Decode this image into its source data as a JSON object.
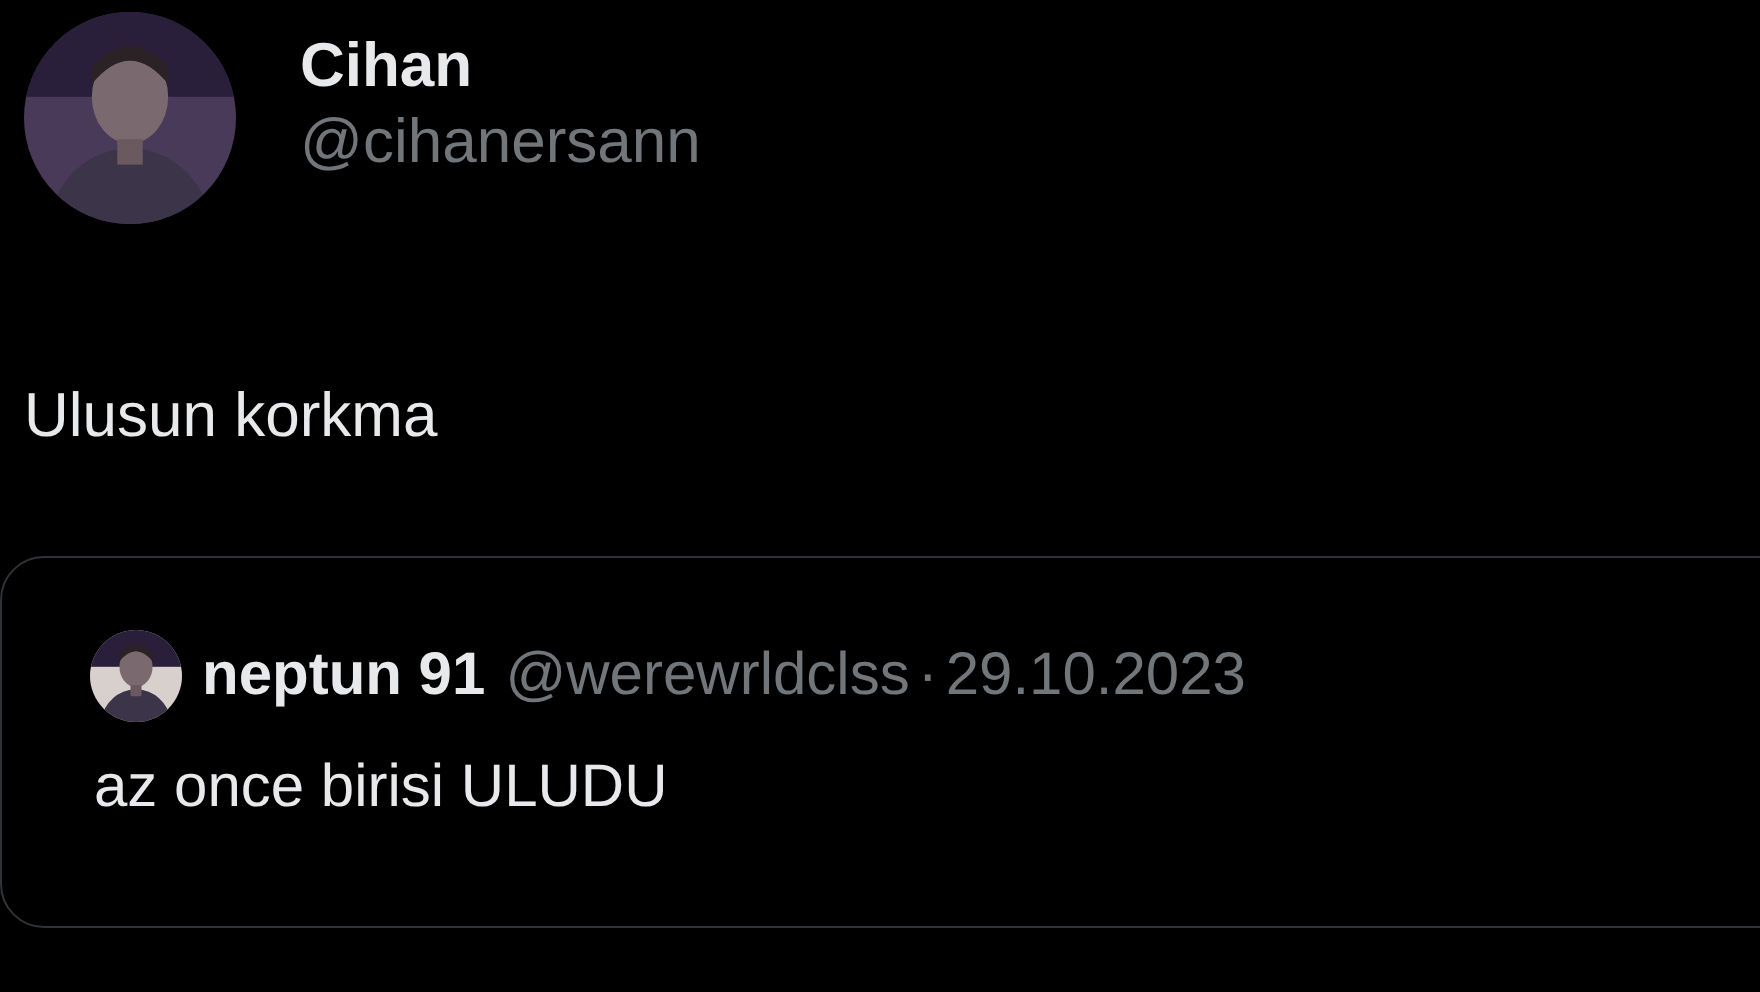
{
  "tweet": {
    "author": {
      "name": "Cihan",
      "handle": "@cihanersann"
    },
    "text": "Ulusun korkma",
    "quote": {
      "author": {
        "name": "neptun 91",
        "handle": "@werewrldclss"
      },
      "separator": "·",
      "date": "29.10.2023",
      "text": "az once birisi ULUDU"
    }
  }
}
